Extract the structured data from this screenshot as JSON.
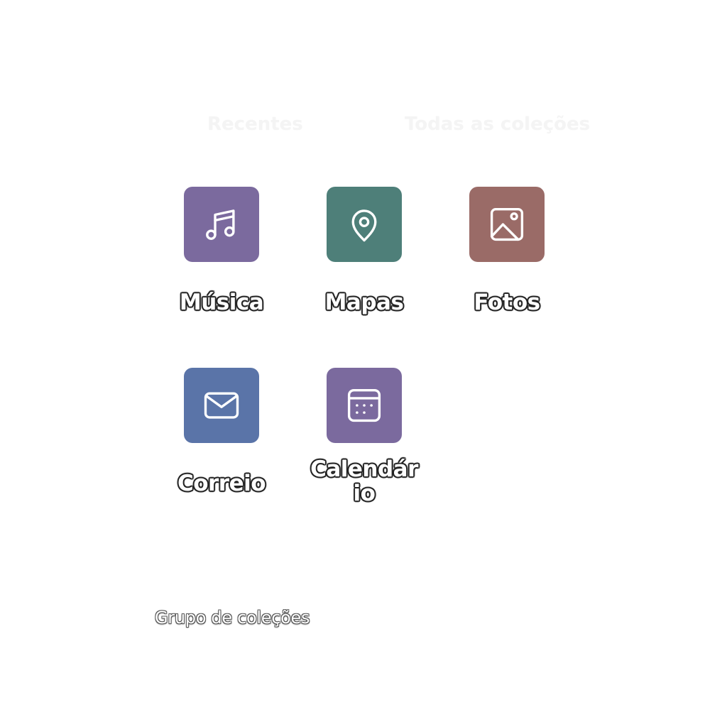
{
  "header": {
    "tabs": [
      "Recentes",
      "Todas as coleções"
    ]
  },
  "tiles": [
    {
      "label": "Música",
      "icon": "music-note-icon",
      "color": "#7B6A9E"
    },
    {
      "label": "Mapas",
      "icon": "map-pin-icon",
      "color": "#4E7F79"
    },
    {
      "label": "Fotos",
      "icon": "image-icon",
      "color": "#9A6B67"
    },
    {
      "label": "Correio",
      "icon": "mail-icon",
      "color": "#5A74A8"
    },
    {
      "label": "Calendário",
      "icon": "calendar-icon",
      "color": "#7B6A9E"
    }
  ],
  "footer": {
    "label": "Grupo de coleções"
  }
}
